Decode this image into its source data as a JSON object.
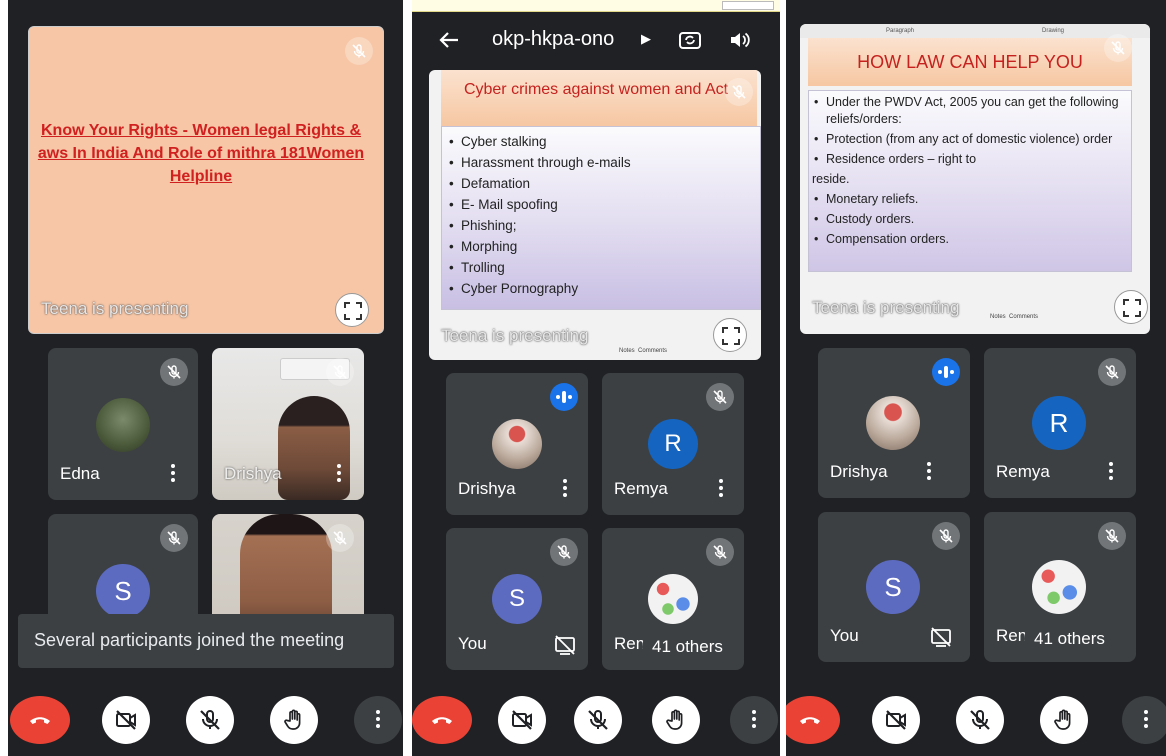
{
  "panel1": {
    "slide_title": "Know Your Rights - Women legal Rights & aws In India  And Role of mithra 181Women Helpline",
    "presenting_label": "Teena is presenting",
    "tiles": [
      {
        "name": "Edna",
        "type": "photo-avatar"
      },
      {
        "name": "Drishya",
        "type": "video"
      },
      {
        "name": "",
        "initial": "S",
        "type": "initial-avatar"
      },
      {
        "name": "",
        "type": "video"
      }
    ],
    "toast": "Several participants joined the meeting"
  },
  "panel2": {
    "meeting_code": "okp-hkpa-ono",
    "slide_title": "Cyber crimes against women and Act",
    "slide_bullets": [
      "Cyber stalking",
      "Harassment through e-mails",
      "Defamation",
      "E- Mail spoofing",
      "Phishing;",
      "Morphing",
      "Trolling",
      "Cyber Pornography"
    ],
    "presenting_label": "Teena is presenting",
    "footer_notes": "Notes",
    "footer_comments": "Comments",
    "tiles": [
      {
        "name": "Drishya",
        "speaking": true
      },
      {
        "name": "Remya",
        "initial": "R"
      },
      {
        "name": "You",
        "initial": "S"
      },
      {
        "name": "Rem",
        "others_label": "41 others"
      }
    ]
  },
  "panel3": {
    "slide_top_left": "Paragraph",
    "slide_top_right": "Drawing",
    "slide_title": "HOW LAW CAN HELP YOU",
    "slide_bullets": [
      {
        "text": "Under the PWDV Act, 2005 you can get the following reliefs/orders:",
        "bullet": true
      },
      {
        "text": "Protection (from any act of domestic violence) order",
        "bullet": true
      },
      {
        "text": "Residence orders – right to",
        "bullet": true
      },
      {
        "text": "reside.",
        "bullet": false
      },
      {
        "text": "Monetary reliefs.",
        "bullet": true
      },
      {
        "text": "Custody orders.",
        "bullet": true
      },
      {
        "text": "Compensation orders.",
        "bullet": true
      }
    ],
    "presenting_label": "Teena is presenting",
    "footer_notes": "Notes",
    "footer_comments": "Comments",
    "tiles": [
      {
        "name": "Drishya",
        "speaking": true
      },
      {
        "name": "Remya",
        "initial": "R"
      },
      {
        "name": "You",
        "initial": "S"
      },
      {
        "name": "Rem",
        "others_label": "41 others"
      }
    ]
  },
  "colors": {
    "background": "#202124",
    "tile": "#3c4043",
    "end_call": "#ea4335",
    "speaking": "#1a73e8",
    "avatar_s": "#5c6bc0",
    "avatar_r": "#1565c0",
    "slide_title_red": "#c5221f"
  },
  "icons": [
    "mic-off-icon",
    "more-vert-icon",
    "fullscreen-icon",
    "end-call-icon",
    "camera-off-icon",
    "raise-hand-icon",
    "back-arrow-icon",
    "switch-camera-icon",
    "speaker-icon",
    "present-icon",
    "speaking-indicator-icon"
  ]
}
